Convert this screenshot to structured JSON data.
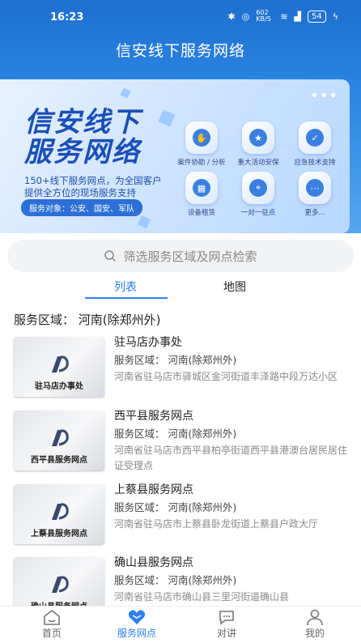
{
  "status_bar": {
    "time": "16:23",
    "net_speed": "602 KB/S",
    "battery": "54"
  },
  "app_title": "信安线下服务网络",
  "banner": {
    "title_line1": "信安线下",
    "title_line2": "服务网络",
    "subtitle_line1": "150+线下服务网点，为全国客户",
    "subtitle_line2": "提供全方位的现场服务支持",
    "target": "服务对象：公安、国安、军队",
    "services": [
      {
        "label": "案件协助 / 分析",
        "icon": "handshake-icon"
      },
      {
        "label": "重大活动安保",
        "icon": "star-shield-icon"
      },
      {
        "label": "应急技术支持",
        "icon": "shield-check-icon"
      },
      {
        "label": "设备租赁",
        "icon": "device-icon"
      },
      {
        "label": "一对一驻点",
        "icon": "location-pin-icon"
      },
      {
        "label": "更多...",
        "icon": "more-icon"
      }
    ]
  },
  "search": {
    "placeholder": "筛选服务区域及网点检索"
  },
  "tabs": [
    {
      "label": "列表",
      "active": true
    },
    {
      "label": "地图",
      "active": false
    }
  ],
  "region_header": "服务区域：  河南(除郑州外)",
  "items": [
    {
      "name": "驻马店办事处",
      "region": "服务区域：  河南(除郑州外)",
      "address": "河南省驻马店市驿城区金河街道丰泽路中段万达小区",
      "thumb_caption": "驻马店办事处"
    },
    {
      "name": "西平县服务网点",
      "region": "服务区域：  河南(除郑州外)",
      "address": "河南省驻马店市西平县柏亭街道西平县港澳台居民居住证受理点",
      "thumb_caption": "西平县服务网点"
    },
    {
      "name": "上蔡县服务网点",
      "region": "服务区域：  河南(除郑州外)",
      "address": "河南省驻马店市上蔡县卧龙街道上蔡县户政大厅",
      "thumb_caption": "上蔡县服务网点"
    },
    {
      "name": "确山县服务网点",
      "region": "服务区域：  河南(除郑州外)",
      "address": "河南省驻马店市确山县三里河街道确山县",
      "thumb_caption": "确山县服务网点"
    }
  ],
  "bottom_nav": [
    {
      "label": "首页",
      "icon": "home-icon",
      "active": false
    },
    {
      "label": "服务网点",
      "icon": "heart-icon",
      "active": true
    },
    {
      "label": "对讲",
      "icon": "chat-icon",
      "active": false
    },
    {
      "label": "我的",
      "icon": "user-icon",
      "active": false
    }
  ],
  "colors": {
    "accent": "#2d7ff0",
    "header": "#1f6fd0"
  }
}
